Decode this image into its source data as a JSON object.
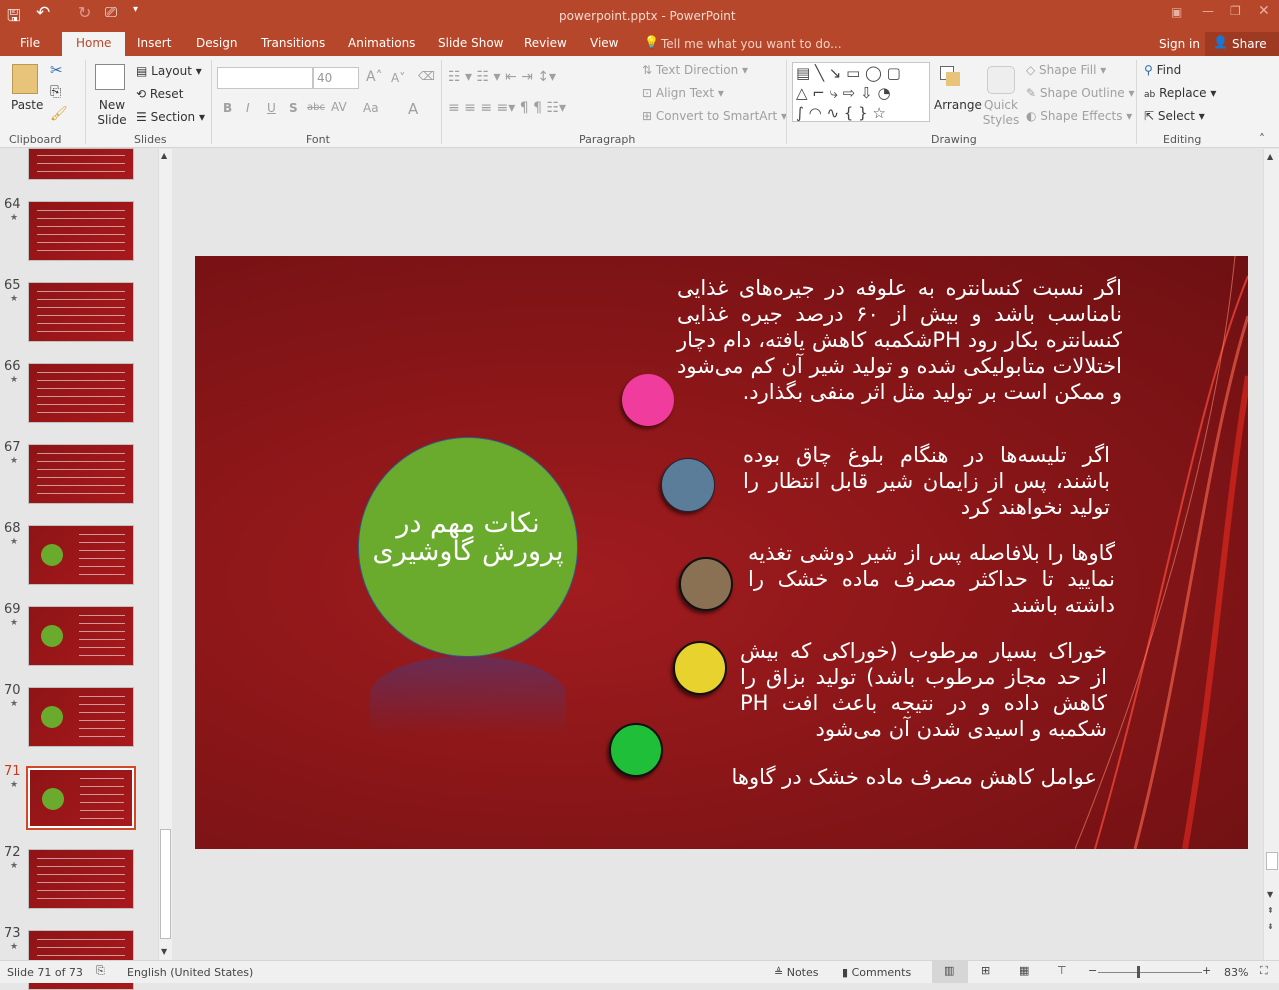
{
  "window": {
    "title": "powerpoint.pptx - PowerPoint"
  },
  "tabs": [
    "File",
    "Home",
    "Insert",
    "Design",
    "Transitions",
    "Animations",
    "Slide Show",
    "Review",
    "View"
  ],
  "tell_me": "Tell me what you want to do...",
  "sign_in": "Sign in",
  "share": "Share",
  "ribbon": {
    "clipboard": {
      "paste": "Paste",
      "label": "Clipboard"
    },
    "slides": {
      "new_slide": "New Slide",
      "layout": "Layout",
      "reset": "Reset",
      "section": "Section",
      "label": "Slides"
    },
    "font": {
      "name": "",
      "size": "40",
      "label": "Font",
      "bold": "B",
      "italic": "I",
      "underline": "U",
      "shadow": "S",
      "strike": "abc",
      "spacing": "AV",
      "case": "Aa",
      "color": "A"
    },
    "paragraph": {
      "text_direction": "Text Direction",
      "align_text": "Align Text",
      "convert": "Convert to SmartArt",
      "label": "Paragraph"
    },
    "drawing": {
      "arrange": "Arrange",
      "quick_styles": "Quick Styles",
      "shape_fill": "Shape Fill",
      "shape_outline": "Shape Outline",
      "shape_effects": "Shape Effects",
      "label": "Drawing"
    },
    "editing": {
      "find": "Find",
      "replace": "Replace",
      "select": "Select",
      "label": "Editing"
    }
  },
  "thumbnails": [
    {
      "num": "64"
    },
    {
      "num": "65"
    },
    {
      "num": "66"
    },
    {
      "num": "67"
    },
    {
      "num": "68"
    },
    {
      "num": "69"
    },
    {
      "num": "70"
    },
    {
      "num": "71",
      "selected": true
    },
    {
      "num": "72"
    },
    {
      "num": "73"
    }
  ],
  "slide": {
    "center_title": "نکات مهم در\nپرورش گاوشیری",
    "center_color": "#6aaa2c",
    "items": [
      {
        "text": "اگر نسبت کنسانتره به علوفه در جیره‌های غذایی نامناسب باشد و بیش از ۶۰ درصد جیره غذایی کنسانتره بکار رود   PHشکمبه کاهش یافته، دام دچار اختلالات متابولیکی شده و تولید شیر آن کم می‌شود و ممکن است بر تولید مثل اثر منفی بگذارد.",
        "color": "#f03c9c"
      },
      {
        "text": "اگر تلیسه‌ها در هنگام بلوغ چاق بوده باشند، پس از زایمان شیر قابل انتظار را تولید نخواهند کرد",
        "color": "#5b7d9a"
      },
      {
        "text": "گاوها را بلافاصله پس از شیر دوشی تغذیه نمایید تا حداکثر مصرف ماده خشک را داشته باشند",
        "color": "#8b7154"
      },
      {
        "text": "خوراک بسیار مرطوب (خوراکی که بیش از حد مجاز مرطوب باشد) تولید بزاق را کاهش داده  و در نتیجه باعث افت  PH شکمبه و اسیدی شدن آن می‌شود",
        "color": "#e8d22e"
      },
      {
        "text": "عوامل کاهش مصرف ماده خشک در گاوها",
        "color": "#1fbf3a"
      }
    ]
  },
  "status": {
    "slide": "Slide 71 of 73",
    "language": "English (United States)",
    "notes": "Notes",
    "comments": "Comments",
    "zoom": "83%"
  }
}
